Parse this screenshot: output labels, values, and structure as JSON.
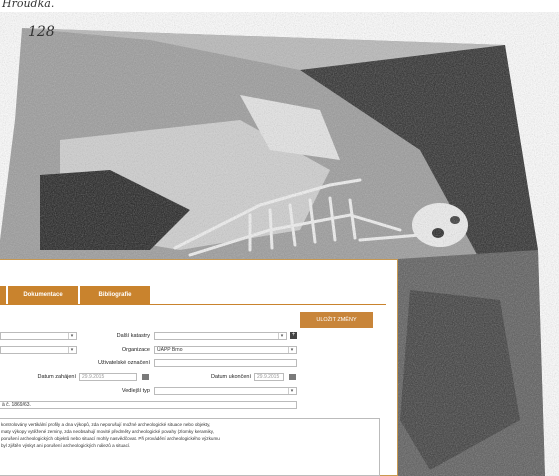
{
  "photo": {
    "caption_top": "Hroudka.",
    "number": "128"
  },
  "tabs": [
    {
      "label": ""
    },
    {
      "label": "Dokumentace"
    },
    {
      "label": "Bibliografie"
    }
  ],
  "toolbar": {
    "save_label": "ULOŽIT ZMĚNY"
  },
  "form": {
    "dalsi_katastry_label": "Další katastry",
    "organizace_label": "Organizace",
    "organizace_value": "ÚAPP Brno",
    "uziv_oznaceni_label": "Uživatelské označení",
    "datum_zahajeni_label": "Datum zahájení",
    "datum_zahajeni_value": "29.9.2015",
    "datum_ukonceni_label": "Datum ukončení",
    "datum_ukonceni_value": "29.9.2015",
    "vedlejsi_typ_label": "Vedlejší typ",
    "note_line": "ä č. 1869/63."
  },
  "description": {
    "lines": [
      "kontrolovány vertikální profily a dna výkopů, zda neporušují možné archeologické situace nebo objekty,",
      "maty výkopy vytěžené zeminy, zda neobsahují movité předměty archeologické povahy (zlomky keramiky,",
      "porušení archeologických objektů nebo situací mohly nasvědčovat. Při provádění archeologického výzkumu",
      "byl zjištěn výskyt ani porušení archeologických nálezů a situací."
    ]
  },
  "colors": {
    "accent": "#c9832d",
    "border": "#c79850"
  }
}
